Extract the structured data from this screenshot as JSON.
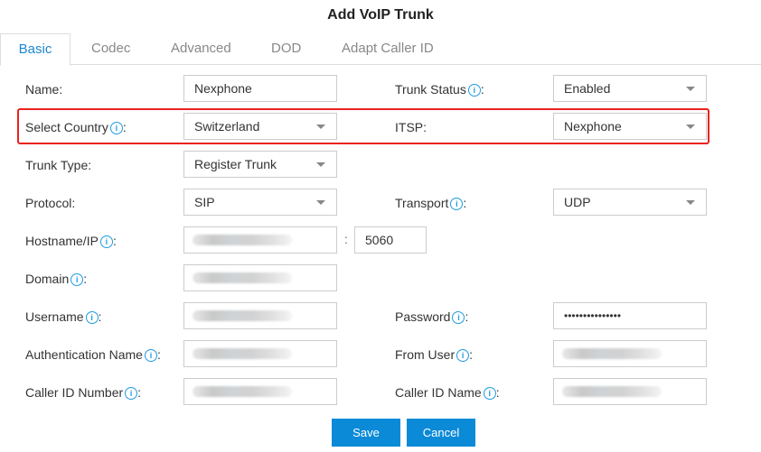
{
  "dialog": {
    "title": "Add VoIP Trunk"
  },
  "tabs": [
    {
      "label": "Basic",
      "active": true
    },
    {
      "label": "Codec",
      "active": false
    },
    {
      "label": "Advanced",
      "active": false
    },
    {
      "label": "DOD",
      "active": false
    },
    {
      "label": "Adapt Caller ID",
      "active": false
    }
  ],
  "icons": {
    "info": "info-circle-icon",
    "dropdown": "caret-down-icon",
    "info_glyph": "i"
  },
  "form": {
    "name": {
      "label": "Name:",
      "value": "Nexphone"
    },
    "trunk_status": {
      "label": "Trunk Status",
      "value": "Enabled"
    },
    "select_country": {
      "label": "Select Country",
      "value": "Switzerland"
    },
    "itsp": {
      "label": "ITSP:",
      "value": "Nexphone"
    },
    "trunk_type": {
      "label": "Trunk Type:",
      "value": "Register Trunk"
    },
    "protocol": {
      "label": "Protocol:",
      "value": "SIP"
    },
    "transport": {
      "label": "Transport",
      "value": "UDP"
    },
    "hostname": {
      "label": "Hostname/IP",
      "value": "",
      "port": "5060",
      "separator": ":"
    },
    "domain": {
      "label": "Domain",
      "value": ""
    },
    "username": {
      "label": "Username",
      "value": ""
    },
    "password": {
      "label": "Password",
      "value": "•••••••••••••••"
    },
    "auth_name": {
      "label": "Authentication Name",
      "value": ""
    },
    "from_user": {
      "label": "From User",
      "value": ""
    },
    "caller_id_number": {
      "label": "Caller ID Number",
      "value": ""
    },
    "caller_id_name": {
      "label": "Caller ID Name",
      "value": ""
    },
    "colon": ":"
  },
  "buttons": {
    "save": "Save",
    "cancel": "Cancel"
  },
  "colors": {
    "accent": "#0b8ad8",
    "highlight": "#e8231f",
    "active_tab": "#1e88d3"
  }
}
